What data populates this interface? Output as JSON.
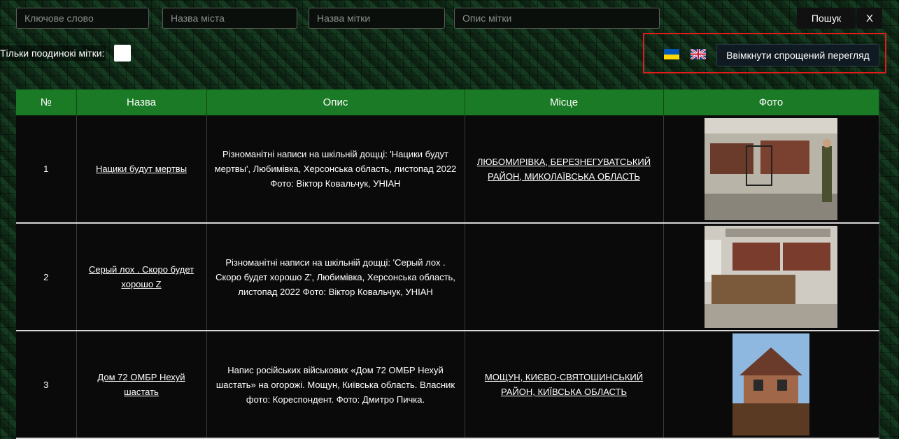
{
  "search": {
    "keyword_placeholder": "Ключове слово",
    "city_placeholder": "Назва міста",
    "tag_placeholder": "Назва мітки",
    "desc_placeholder": "Опис мітки",
    "search_label": "Пошук",
    "close_label": "X"
  },
  "filters": {
    "single_tags_label": "Тільки поодинокі мітки:"
  },
  "toolbar": {
    "simple_view_label": "Ввімкнути спрощений перегляд",
    "flag_ua_icon": "ukraine-flag-icon",
    "flag_uk_icon": "uk-flag-icon"
  },
  "table": {
    "headers": [
      "№",
      "Назва",
      "Опис",
      "Місце",
      "Фото"
    ],
    "rows": [
      {
        "num": "1",
        "name": "Нацики будут мертвы",
        "desc": "Різноманітні написи на шкільній дощці: 'Нацики будут мертвы', Любимівка, Херсонська область, листопад 2022 Фото: Віктор Ковальчук, УНІАН",
        "place": "ЛЮБОМИРІВКА, БЕРЕЗНЕГУВАТСЬКИЙ РАЙОН, МИКОЛАЇВСЬКА ОБЛАСТЬ"
      },
      {
        "num": "2",
        "name": "Серый лох . Скоро будет хорошо Z",
        "desc": "Різноманітні написи на шкільній дощці: 'Серый лох . Скоро будет хорошо Z', Любимівка, Херсонська область, листопад 2022 Фото: Віктор Ковальчук, УНІАН",
        "place": ""
      },
      {
        "num": "3",
        "name": "Дом 72 ОМБР Нехуй шастать",
        "desc": "Напис російських військових «Дом 72 ОМБР Нехуй шастать» на огорожі. Мощун, Київська область. Власник фото: Кореспондент. Фото: Дмитро Пичка.",
        "place": "МОЩУН, КИЄВО-СВЯТОШИНСЬКИЙ РАЙОН, КИЇВСЬКА ОБЛАСТЬ"
      }
    ]
  },
  "colors": {
    "header_green": "#1b7a25",
    "highlight_red": "#e51b1b"
  }
}
